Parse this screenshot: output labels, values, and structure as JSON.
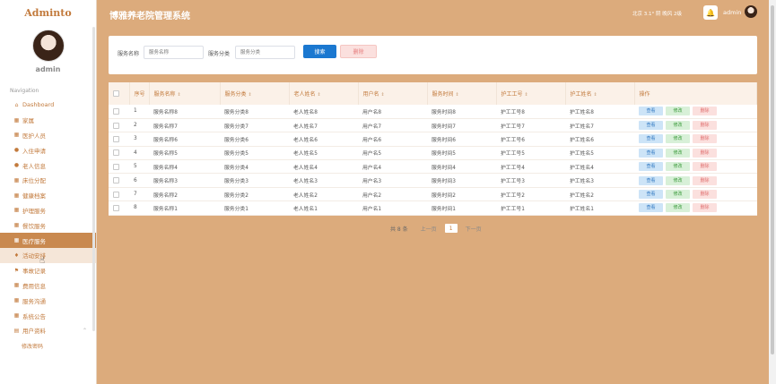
{
  "sidebar": {
    "brand": "Adminto",
    "user_name": "admin",
    "nav_title": "Navigation",
    "items": [
      {
        "label": "Dashboard",
        "icon": "home-icon"
      },
      {
        "label": "家属",
        "icon": "grid-icon"
      },
      {
        "label": "医护人员",
        "icon": "grid-icon"
      },
      {
        "label": "入住申请",
        "icon": "person-icon"
      },
      {
        "label": "老人信息",
        "icon": "person-icon"
      },
      {
        "label": "床位分配",
        "icon": "grid-icon"
      },
      {
        "label": "健康档案",
        "icon": "grid-icon"
      },
      {
        "label": "护理服务",
        "icon": "grid-icon"
      },
      {
        "label": "餐饮服务",
        "icon": "grid-icon"
      },
      {
        "label": "医疗服务",
        "icon": "grid-icon"
      },
      {
        "label": "活动安排",
        "icon": "drop-icon"
      },
      {
        "label": "事故记录",
        "icon": "flag-icon"
      },
      {
        "label": "费用信息",
        "icon": "grid-icon"
      },
      {
        "label": "服务沟通",
        "icon": "grid-icon"
      },
      {
        "label": "系统公告",
        "icon": "grid-icon"
      },
      {
        "label": "用户资料",
        "icon": "doc-icon"
      }
    ],
    "sub_item": "修改密码"
  },
  "header": {
    "title": "博雅养老院管理系统",
    "weather": "北京  3.1°  阴  晚风  2级",
    "user": "admin"
  },
  "search": {
    "name_label": "服务名称",
    "name_placeholder": "服务名称",
    "category_label": "服务分类",
    "category_placeholder": "服务分类",
    "search_button": "搜索",
    "delete_button": "删除"
  },
  "table": {
    "columns": [
      "序号",
      "服务名称",
      "服务分类",
      "老人姓名",
      "用户名",
      "服务时间",
      "护工工号",
      "护工姓名",
      "操作"
    ],
    "rows": [
      [
        "1",
        "服务名称8",
        "服务分类8",
        "老人姓名8",
        "用户名8",
        "服务时间8",
        "护工工号8",
        "护工姓名8"
      ],
      [
        "2",
        "服务名称7",
        "服务分类7",
        "老人姓名7",
        "用户名7",
        "服务时间7",
        "护工工号7",
        "护工姓名7"
      ],
      [
        "3",
        "服务名称6",
        "服务分类6",
        "老人姓名6",
        "用户名6",
        "服务时间6",
        "护工工号6",
        "护工姓名6"
      ],
      [
        "4",
        "服务名称5",
        "服务分类5",
        "老人姓名5",
        "用户名5",
        "服务时间5",
        "护工工号5",
        "护工姓名5"
      ],
      [
        "5",
        "服务名称4",
        "服务分类4",
        "老人姓名4",
        "用户名4",
        "服务时间4",
        "护工工号4",
        "护工姓名4"
      ],
      [
        "6",
        "服务名称3",
        "服务分类3",
        "老人姓名3",
        "用户名3",
        "服务时间3",
        "护工工号3",
        "护工姓名3"
      ],
      [
        "7",
        "服务名称2",
        "服务分类2",
        "老人姓名2",
        "用户名2",
        "服务时间2",
        "护工工号2",
        "护工姓名2"
      ],
      [
        "8",
        "服务名称1",
        "服务分类1",
        "老人姓名1",
        "用户名1",
        "服务时间1",
        "护工工号1",
        "护工姓名1"
      ]
    ],
    "actions": {
      "view": "查看",
      "edit": "修改",
      "delete": "删除"
    }
  },
  "pagination": {
    "total": "共 8 条",
    "prev": "上一页",
    "current": "1",
    "next": "下一页"
  },
  "colors": {
    "background": "#dcab7c",
    "accent": "#c27a3c",
    "active_nav": "#c9894f",
    "primary_button": "#1b78d0"
  }
}
